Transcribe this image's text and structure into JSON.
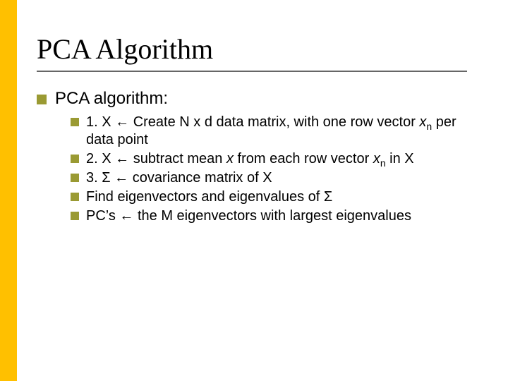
{
  "slide": {
    "title": "PCA Algorithm",
    "bullet_glyph": "■",
    "arrow": "←",
    "level1": {
      "text": "PCA algorithm:"
    },
    "level2": [
      {
        "prefix": "1. X ",
        "arrow": "←",
        "rest": " Create N x d data matrix, with one row vector ",
        "sub_var": "x",
        "sub_idx": "n",
        "tail": " per data point"
      },
      {
        "prefix": "2. X ",
        "arrow": "←",
        "rest": " subtract mean ",
        "ital1": "x",
        "mid": " from each row vector ",
        "sub_var": "x",
        "sub_idx": "n",
        "tail": " in X"
      },
      {
        "prefix": "3. Σ ",
        "arrow": "←",
        "rest": " covariance matrix of X"
      },
      {
        "prefix": "Find eigenvectors and eigenvalues of Σ"
      },
      {
        "prefix": "PC’s ",
        "arrow": "←",
        "rest": " the M eigenvectors with largest eigenvalues"
      }
    ]
  }
}
